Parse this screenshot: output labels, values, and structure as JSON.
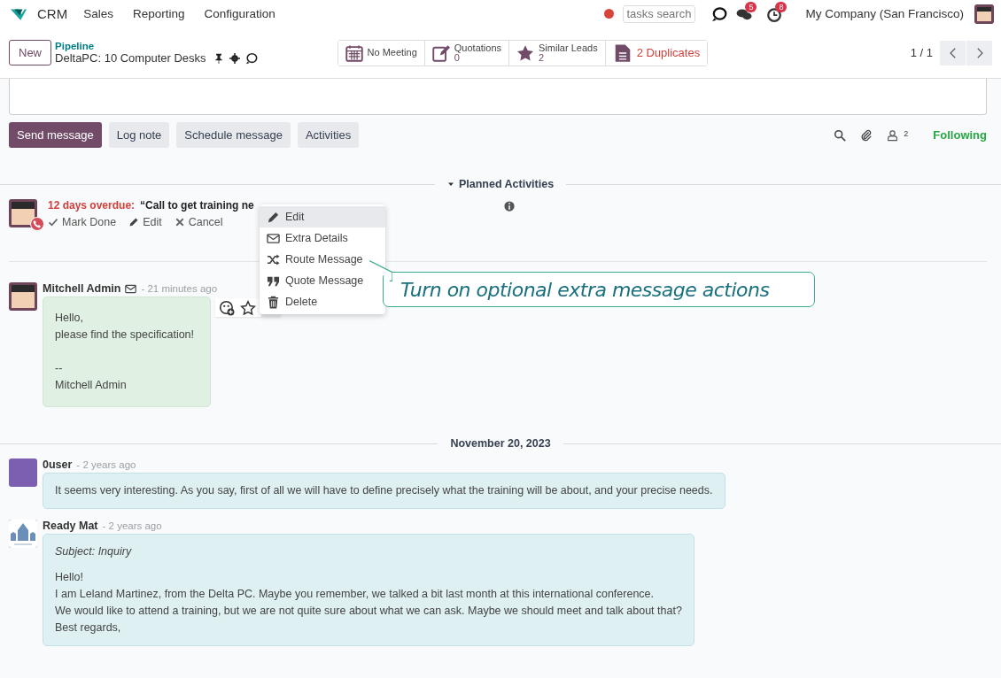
{
  "navbar": {
    "app": "CRM",
    "menu": [
      "Sales",
      "Reporting",
      "Configuration"
    ],
    "search": {
      "placeholder": "tasks search"
    },
    "messages_count": "5",
    "activities_count": "8",
    "company": "My Company (San Francisco)"
  },
  "control_panel": {
    "new_button": "New",
    "breadcrumb": "Pipeline",
    "record": "DeltaPC: 10 Computer Desks",
    "smart_buttons": [
      {
        "kind": "calendar",
        "label": "No Meeting"
      },
      {
        "kind": "quote",
        "label": "Quotations",
        "value": "0"
      },
      {
        "kind": "star",
        "label": "Similar Leads",
        "value": "2"
      },
      {
        "kind": "duplicate",
        "label": "2 Duplicates"
      }
    ],
    "pager": "1 / 1"
  },
  "chatter": {
    "buttons": [
      {
        "label": "Send message",
        "selected": true
      },
      {
        "label": "Log note",
        "selected": false
      },
      {
        "label": "Schedule message",
        "selected": false
      },
      {
        "label": "Activities",
        "selected": false
      }
    ],
    "followers_count": "2",
    "following": "Following",
    "planned_heading": "Planned Activities",
    "activity": {
      "overdue": "12 days overdue:",
      "title": "“Call to get training ne",
      "actions": [
        {
          "kind": "check",
          "label": "Mark Done"
        },
        {
          "kind": "edit",
          "label": "Edit"
        },
        {
          "kind": "cancel",
          "label": "Cancel"
        }
      ]
    },
    "menu": [
      {
        "kind": "edit",
        "label": "Edit",
        "selected": true
      },
      {
        "kind": "mail",
        "label": "Extra Details",
        "selected": false
      },
      {
        "kind": "shuffle",
        "label": "Route Message",
        "selected": false
      },
      {
        "kind": "quote",
        "label": "Quote Message",
        "selected": false
      },
      {
        "kind": "trash",
        "label": "Delete",
        "selected": false
      }
    ],
    "tooltip": "Turn on optional extra message actions",
    "messages": [
      {
        "kind": "note",
        "author": "Mitchell Admin",
        "avatar": {
          "kind": "cartoon"
        },
        "mail": true,
        "time": "- 21 minutes ago",
        "paragraphs": [
          [
            "Hello,",
            "please find the specification!"
          ],
          [
            "--",
            "Mitchell Admin"
          ]
        ],
        "toolbar": true
      },
      {
        "kind": "date",
        "label": "November 20, 2023"
      },
      {
        "kind": "mail",
        "author": "0user",
        "avatar": {
          "kind": "photo"
        },
        "mail": false,
        "time": "- 2 years ago",
        "paragraphs": [
          [
            "It seems very interesting. As you say, first of all we will have to define precisely what the training will be about, and your precise needs."
          ]
        ],
        "toolbar": false
      },
      {
        "kind": "mail",
        "author": "Ready Mat",
        "avatar": {
          "kind": "logo"
        },
        "mail": false,
        "time": "- 2 years ago",
        "subject": "Subject: Inquiry",
        "paragraphs": [
          [
            "Hello!",
            "I am Leland Martinez, from the Delta PC. Maybe you remember, we talked a bit last month at this international conference.",
            "We would like to attend a training, but we are not quite sure about what we can ask. Maybe we should meet and talk about that?",
            "Best regards,"
          ]
        ],
        "toolbar": false
      }
    ]
  }
}
